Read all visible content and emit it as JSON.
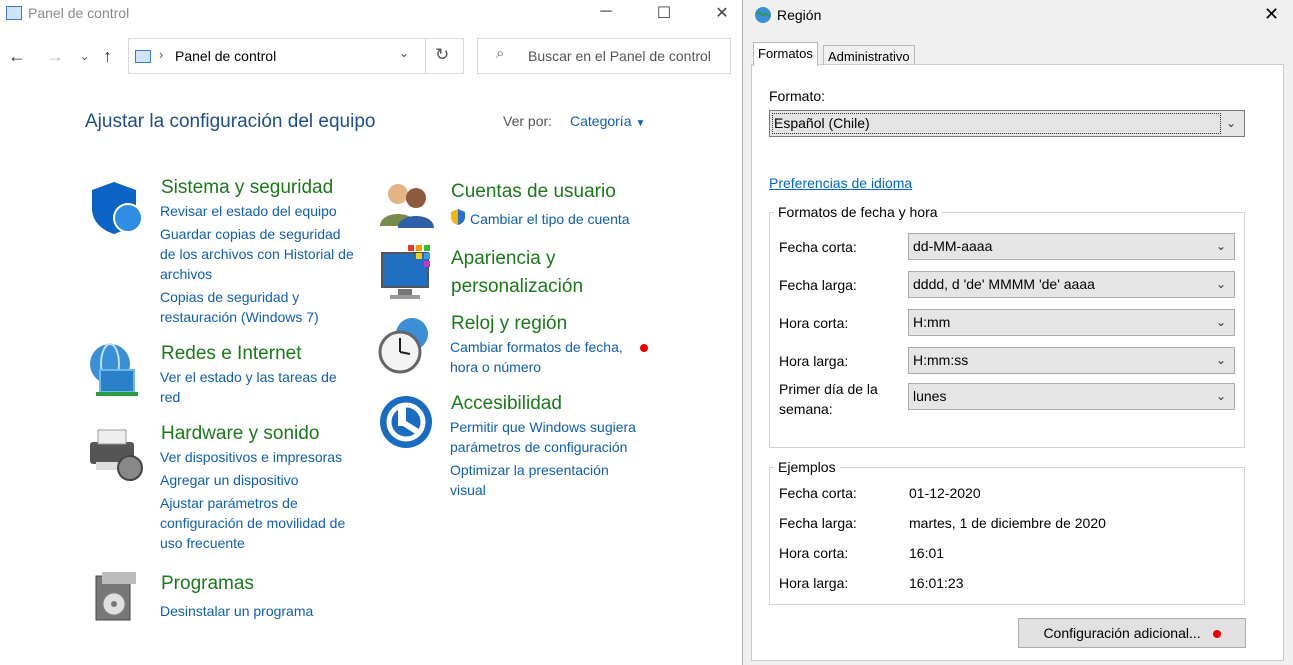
{
  "control_panel": {
    "window_title": "Panel de control",
    "address": "Panel de control",
    "search_placeholder": "Buscar en el Panel de control",
    "heading": "Ajustar la configuración del equipo",
    "view_by_label": "Ver por:",
    "view_by_value": "Categoría",
    "categories": {
      "sistema": {
        "title": "Sistema y seguridad",
        "links": [
          "Revisar el estado del equipo",
          "Guardar copias de seguridad de los archivos con Historial de archivos",
          "Copias de seguridad y restauración (Windows 7)"
        ]
      },
      "redes": {
        "title": "Redes e Internet",
        "links": [
          "Ver el estado y las tareas de red"
        ]
      },
      "hardware": {
        "title": "Hardware y sonido",
        "links": [
          "Ver dispositivos e impresoras",
          "Agregar un dispositivo",
          "Ajustar parámetros de configuración de movilidad de uso frecuente"
        ]
      },
      "programas": {
        "title": "Programas",
        "links": [
          "Desinstalar un programa"
        ]
      },
      "cuentas": {
        "title": "Cuentas de usuario",
        "links": [
          "Cambiar el tipo de cuenta"
        ]
      },
      "apariencia": {
        "title": "Apariencia y personalización"
      },
      "reloj": {
        "title": "Reloj y región",
        "links": [
          "Cambiar formatos de fecha, hora o número"
        ]
      },
      "accesibilidad": {
        "title": "Accesibilidad",
        "links": [
          "Permitir que Windows sugiera parámetros de configuración",
          "Optimizar la presentación visual"
        ]
      }
    }
  },
  "region": {
    "title": "Región",
    "tabs": [
      "Formatos",
      "Administrativo"
    ],
    "format_label": "Formato:",
    "format_value": "Español (Chile)",
    "language_prefs_link": "Preferencias de idioma",
    "date_time_group": "Formatos de fecha y hora",
    "fields": [
      {
        "label": "Fecha corta:",
        "value": "dd-MM-aaaa"
      },
      {
        "label": "Fecha larga:",
        "value": "dddd, d 'de' MMMM 'de' aaaa"
      },
      {
        "label": "Hora corta:",
        "value": "H:mm"
      },
      {
        "label": "Hora larga:",
        "value": "H:mm:ss"
      },
      {
        "label": "Primer día de la semana:",
        "value": "lunes"
      }
    ],
    "examples_group": "Ejemplos",
    "examples": [
      {
        "label": "Fecha corta:",
        "value": "01-12-2020"
      },
      {
        "label": "Fecha larga:",
        "value": "martes, 1 de diciembre de 2020"
      },
      {
        "label": "Hora corta:",
        "value": "16:01"
      },
      {
        "label": "Hora larga:",
        "value": "16:01:23"
      }
    ],
    "additional_button": "Configuración adicional..."
  },
  "colors": {
    "link": "#0f5fb4",
    "category": "#1a7a1a",
    "heading": "#1f4e8c",
    "marker": "#e00000"
  }
}
